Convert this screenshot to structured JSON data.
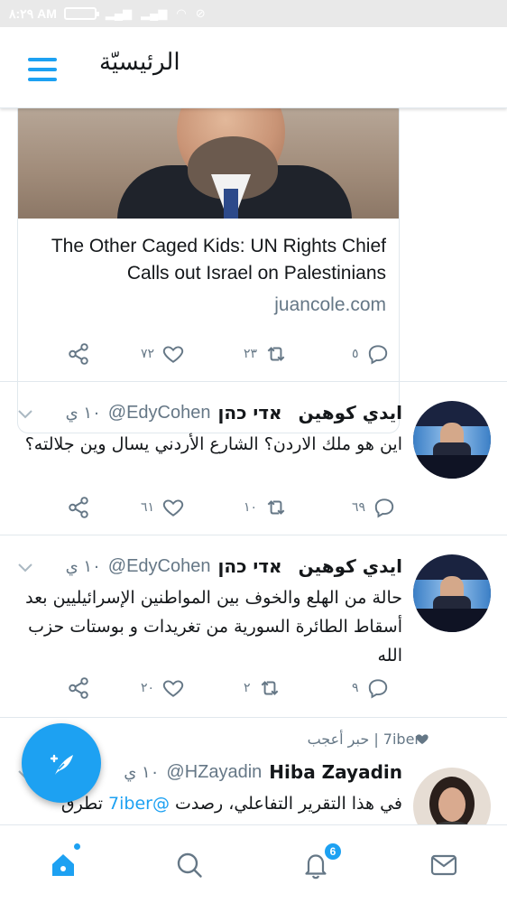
{
  "status_bar": {
    "time": "٨:٢٩ AM"
  },
  "app_bar": {
    "title": "الرئيسيّة"
  },
  "card": {
    "title": "The Other Caged Kids: UN Rights Chief Calls out Israel on Palestinians",
    "domain": "juancole.com",
    "actions": {
      "share": "",
      "likes": "٧٢",
      "retweets": "٢٣",
      "replies": "٥"
    }
  },
  "tweets": [
    {
      "name_ar": "ايدي كوهين",
      "name_he": "אדי כהן",
      "handle": "@EdyCohen",
      "time": "١٠ ي",
      "text": "اين هو ملك الاردن؟ الشارع الأردني يسال وين جلالته؟",
      "actions": {
        "likes": "٦١",
        "retweets": "١٠",
        "replies": "٦٩"
      }
    },
    {
      "name_ar": "ايدي كوهين",
      "name_he": "אדי כהן",
      "handle": "@EdyCohen",
      "time": "١٠ ي",
      "text": "حالة من الهلع والخوف بين المواطنين الإسرائيليين بعد أسقاط الطائرة السورية من تغريدات و بوستات حزب الله",
      "actions": {
        "likes": "٢٠",
        "retweets": "٢",
        "replies": "٩"
      }
    },
    {
      "social_context": "7iber | حبر أعجب",
      "name": "Hiba Zayadin",
      "handle": "@HZayadin",
      "time": "١٠ ي",
      "text_prefix": "في هذا التقرير التفاعلي، رصدت ",
      "text_mention": "@7iber",
      "text_suffix": " تطرق"
    }
  ],
  "tab_bar": {
    "notifications_badge": "6"
  },
  "colors": {
    "accent": "#1da1f2",
    "secondary_text": "#657786",
    "border": "#e1e8ed"
  }
}
